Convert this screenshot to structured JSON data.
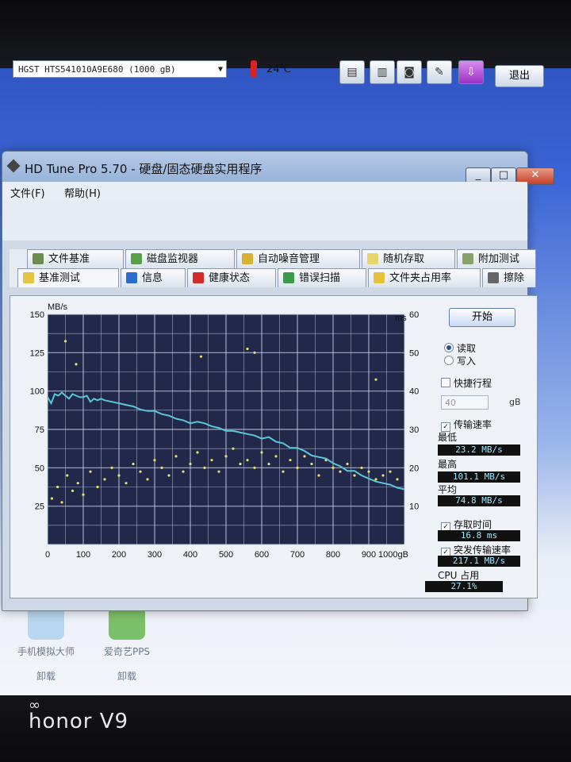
{
  "window": {
    "title": "HD Tune Pro 5.70 - 硬盘/固态硬盘实用程序"
  },
  "window_controls": {
    "minimize": "_",
    "maximize": "□",
    "close": "✕"
  },
  "menu": {
    "file": "文件(F)",
    "help": "帮助(H)"
  },
  "toolbar": {
    "drive": "HGST   HTS541010A9E680 (1000 gB)",
    "temperature": "24℃",
    "exit_label": "退出"
  },
  "tabs_top": [
    "文件基准",
    "磁盘监视器",
    "自动噪音管理",
    "随机存取",
    "附加测试"
  ],
  "tabs_bottom": [
    "基准测试",
    "信息",
    "健康状态",
    "错误扫描",
    "文件夹占用率",
    "擦除"
  ],
  "side": {
    "start_label": "开始",
    "read_label": "读取",
    "write_label": "写入",
    "short_stroke_label": "快捷行程",
    "short_stroke_value": "40",
    "gb_unit": "gB",
    "transfer_rate_label": "传输速率",
    "min_label": "最低",
    "min_value": "23.2 MB/s",
    "max_label": "最高",
    "max_value": "101.1 MB/s",
    "avg_label": "平均",
    "avg_value": "74.8 MB/s",
    "access_time_label": "存取时间",
    "access_time_value": "16.8 ms",
    "burst_label": "突发传输速率",
    "burst_value": "217.1 MB/s",
    "cpu_label": "CPU 占用",
    "cpu_value": "27.1%"
  },
  "desktop": {
    "icon1_label": "手机模拟大师",
    "icon1_sub": "卸载",
    "icon2_label": "爱奇艺PPS",
    "icon2_sub": "卸载"
  },
  "watermark": {
    "brand": "honor",
    "model": "V9",
    "dots": "∞"
  },
  "colors": {
    "chart_bg": "#22284a",
    "grid": "#c9d2e8",
    "read_line": "#58c8d8",
    "access_points": "#e4e26a"
  },
  "chart_data": {
    "type": "line",
    "left_unit": "MB/s",
    "right_unit": "ms",
    "x_ticks": [
      "0",
      "100",
      "200",
      "300",
      "400",
      "500",
      "600",
      "700",
      "800",
      "900",
      "1000gB"
    ],
    "y_left_ticks": [
      "150",
      "125",
      "100",
      "75",
      "50",
      "25"
    ],
    "y_right_ticks": [
      "60",
      "50",
      "40",
      "30",
      "20",
      "10"
    ],
    "xlim": [
      0,
      1000
    ],
    "ylim_left": [
      0,
      150
    ],
    "ylim_right": [
      0,
      60
    ],
    "series": [
      {
        "x": [
          0,
          10,
          20,
          30,
          40,
          50,
          60,
          70,
          80,
          90,
          100,
          110,
          120,
          130,
          140,
          150,
          160,
          180,
          200,
          220,
          240,
          260,
          280,
          300,
          320,
          340,
          360,
          380,
          400,
          420,
          440,
          460,
          480,
          500,
          520,
          540,
          560,
          580,
          600,
          620,
          640,
          660,
          680,
          700,
          720,
          740,
          760,
          780,
          800,
          820,
          840,
          860,
          880,
          900,
          910,
          920,
          940,
          960,
          980,
          1000
        ],
        "values": [
          96,
          92,
          98,
          97,
          99,
          97,
          95,
          98,
          97,
          96,
          96,
          97,
          93,
          95,
          94,
          95,
          94,
          93,
          92,
          91,
          90,
          88,
          87,
          87,
          85,
          84,
          82,
          81,
          79,
          80,
          79,
          77,
          76,
          74,
          74,
          73,
          72,
          71,
          69,
          70,
          67,
          66,
          63,
          63,
          61,
          58,
          57,
          56,
          53,
          51,
          48,
          48,
          45,
          43,
          42,
          41,
          40,
          39,
          37,
          36
        ]
      }
    ],
    "access_points": {
      "x": [
        12,
        28,
        40,
        55,
        70,
        85,
        100,
        120,
        140,
        160,
        180,
        200,
        220,
        240,
        260,
        280,
        300,
        320,
        340,
        360,
        380,
        400,
        420,
        440,
        460,
        480,
        500,
        520,
        540,
        560,
        580,
        600,
        620,
        640,
        660,
        680,
        700,
        720,
        740,
        760,
        780,
        800,
        820,
        840,
        860,
        880,
        900,
        920,
        940,
        960,
        980
      ],
      "ms": [
        12,
        15,
        11,
        18,
        14,
        16,
        13,
        19,
        15,
        17,
        20,
        18,
        16,
        21,
        19,
        17,
        22,
        20,
        18,
        23,
        19,
        21,
        24,
        20,
        22,
        19,
        23,
        25,
        21,
        22,
        20,
        24,
        21,
        23,
        19,
        22,
        20,
        23,
        21,
        18,
        22,
        20,
        19,
        21,
        18,
        20,
        19,
        17,
        18,
        19,
        17
      ]
    },
    "outliers": {
      "x": [
        50,
        80,
        430,
        560,
        580,
        920
      ],
      "ms": [
        53,
        47,
        49,
        51,
        50,
        43
      ]
    }
  }
}
